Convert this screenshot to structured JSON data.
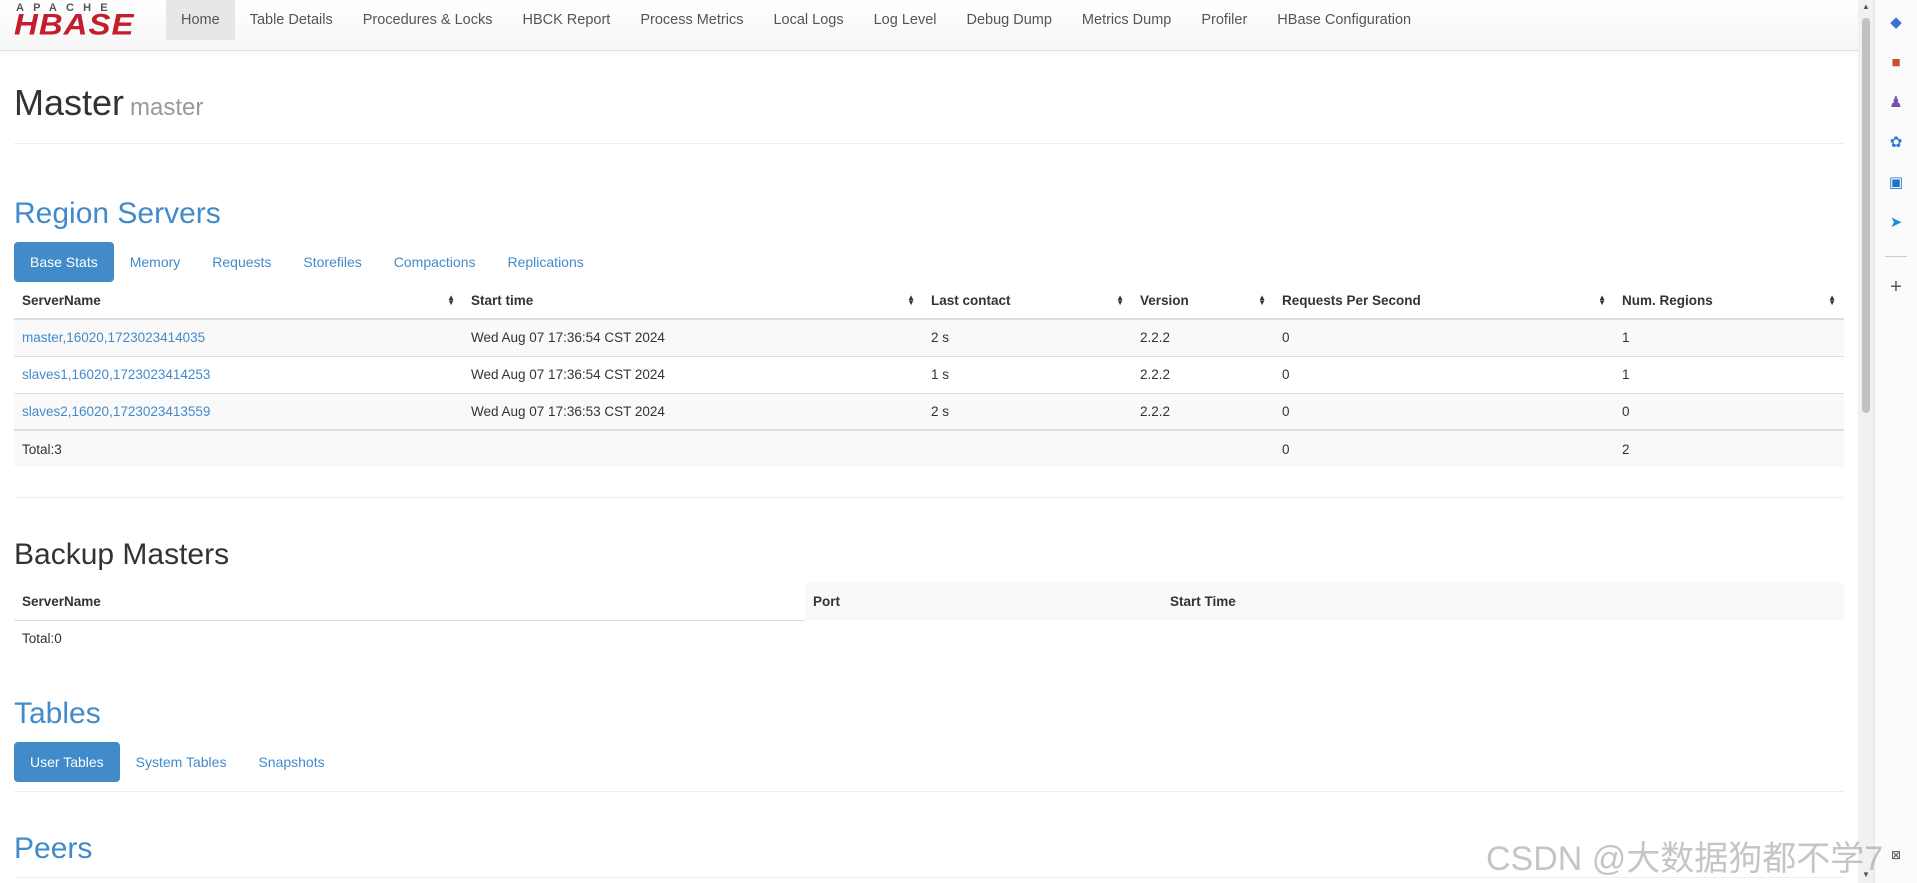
{
  "logo": {
    "apache": "APACHE",
    "hbase": "HBASE"
  },
  "nav": [
    "Home",
    "Table Details",
    "Procedures & Locks",
    "HBCK Report",
    "Process Metrics",
    "Local Logs",
    "Log Level",
    "Debug Dump",
    "Metrics Dump",
    "Profiler",
    "HBase Configuration"
  ],
  "page": {
    "title": "Master",
    "subtitle": "master"
  },
  "region_servers": {
    "heading": "Region Servers",
    "tabs": [
      "Base Stats",
      "Memory",
      "Requests",
      "Storefiles",
      "Compactions",
      "Replications"
    ],
    "columns": [
      "ServerName",
      "Start time",
      "Last contact",
      "Version",
      "Requests Per Second",
      "Num. Regions"
    ],
    "rows": [
      {
        "server": "master,16020,1723023414035",
        "start": "Wed Aug 07 17:36:54 CST 2024",
        "contact": "2 s",
        "version": "2.2.2",
        "rps": "0",
        "regions": "1"
      },
      {
        "server": "slaves1,16020,1723023414253",
        "start": "Wed Aug 07 17:36:54 CST 2024",
        "contact": "1 s",
        "version": "2.2.2",
        "rps": "0",
        "regions": "1"
      },
      {
        "server": "slaves2,16020,1723023413559",
        "start": "Wed Aug 07 17:36:53 CST 2024",
        "contact": "2 s",
        "version": "2.2.2",
        "rps": "0",
        "regions": "0"
      }
    ],
    "total": {
      "label": "Total:3",
      "rps": "0",
      "regions": "2"
    }
  },
  "backup_masters": {
    "heading": "Backup Masters",
    "columns": [
      "ServerName",
      "Port",
      "Start Time"
    ],
    "total": "Total:0"
  },
  "tables": {
    "heading": "Tables",
    "tabs": [
      "User Tables",
      "System Tables",
      "Snapshots"
    ]
  },
  "peers": {
    "heading": "Peers"
  },
  "watermark": "CSDN @大数据狗都不学7",
  "colors": {
    "link": "#428bca",
    "logo_red": "#c21e2b"
  }
}
